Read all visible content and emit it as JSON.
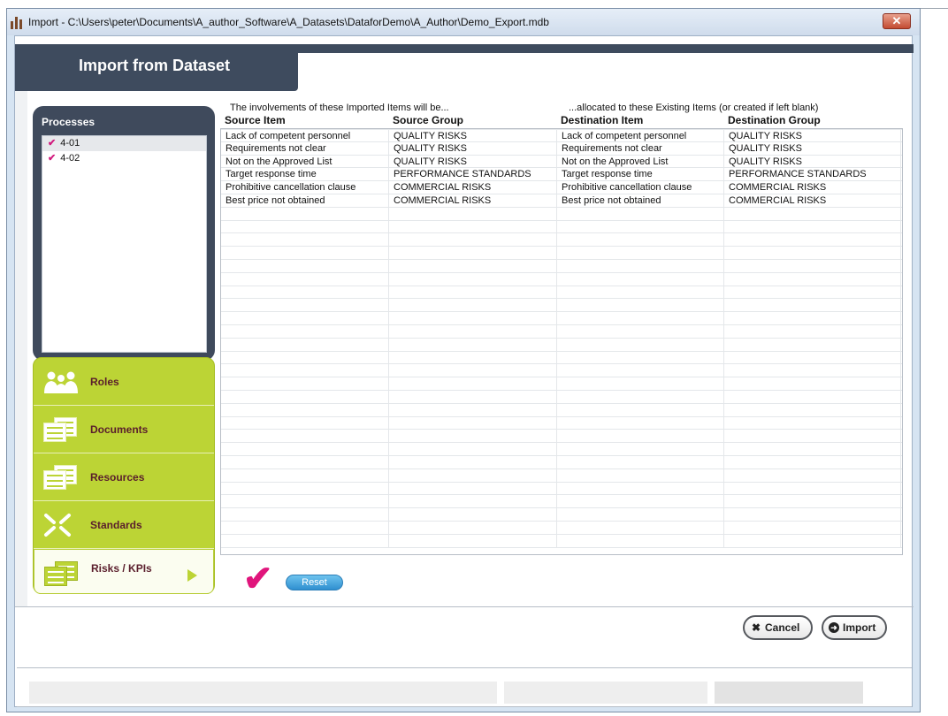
{
  "window": {
    "title": "Import - C:\\Users\\peter\\Documents\\A_author_Software\\A_Datasets\\DataforDemo\\A_Author\\Demo_Export.mdb",
    "close_glyph": "✕",
    "app_icon": "bars-app-icon"
  },
  "header": {
    "title": "Import from Dataset"
  },
  "processes": {
    "title": "Processes",
    "items": [
      {
        "label": "4-01",
        "checked": true,
        "selected": true
      },
      {
        "label": "4-02",
        "checked": true,
        "selected": false
      }
    ]
  },
  "nav": {
    "items": [
      {
        "label": "Roles",
        "icon": "people-icon"
      },
      {
        "label": "Documents",
        "icon": "documents-icon"
      },
      {
        "label": "Resources",
        "icon": "documents-icon"
      },
      {
        "label": "Standards",
        "icon": "arrows-in-icon"
      },
      {
        "label": "Risks / KPIs",
        "icon": "documents-icon",
        "active": true
      }
    ]
  },
  "intro": {
    "left": "The involvements of these Imported Items will be...",
    "right": "...allocated to these Existing Items (or created if left blank)"
  },
  "columns": [
    "Source Item",
    "Source Group",
    "Destination Item",
    "Destination Group"
  ],
  "rows": [
    [
      "Lack of competent personnel",
      "QUALITY RISKS",
      "Lack of competent personnel",
      "QUALITY RISKS"
    ],
    [
      "Requirements not clear",
      "QUALITY RISKS",
      "Requirements not clear",
      "QUALITY RISKS"
    ],
    [
      "Not on the Approved List",
      "QUALITY RISKS",
      "Not on the Approved List",
      "QUALITY RISKS"
    ],
    [
      "Target response time",
      "PERFORMANCE STANDARDS",
      "Target response time",
      "PERFORMANCE STANDARDS"
    ],
    [
      "Prohibitive cancellation clause",
      "COMMERCIAL RISKS",
      "Prohibitive cancellation clause",
      "COMMERCIAL RISKS"
    ],
    [
      "Best price not obtained",
      "COMMERCIAL RISKS",
      "Best price not obtained",
      "COMMERCIAL RISKS"
    ]
  ],
  "actions": {
    "check_glyph": "✔",
    "reset_label": "Reset",
    "cancel_label": "Cancel",
    "cancel_glyph": "✖",
    "import_label": "Import",
    "import_glyph": "➜"
  },
  "colors": {
    "header_bg": "#3e4b5e",
    "nav_green": "#bcd435",
    "nav_label": "#5a1e2c",
    "accent_pink": "#e0157c",
    "reset_blue": "#2f8fd0"
  }
}
